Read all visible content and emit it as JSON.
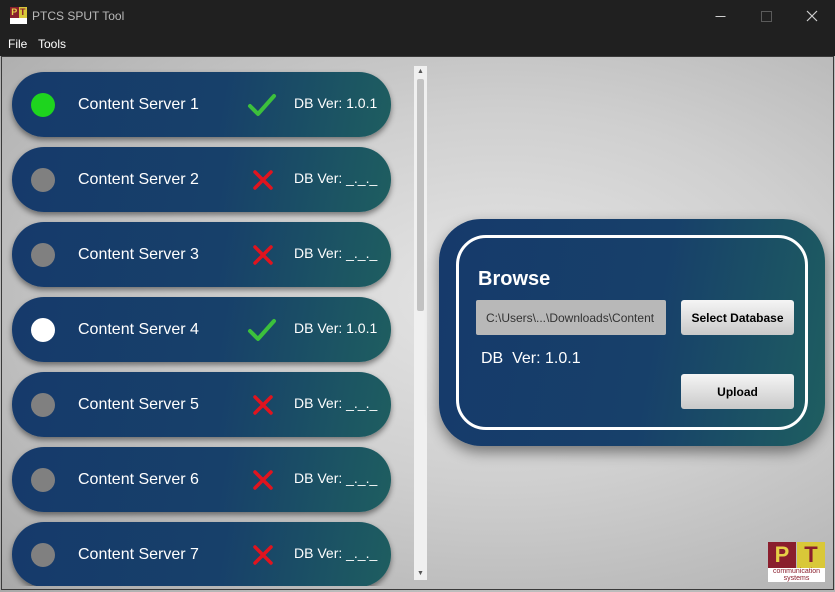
{
  "window": {
    "title": "PTCS SPUT Tool",
    "minimize_glyph": "—",
    "maximize_glyph": "☐",
    "close_glyph": "✕"
  },
  "menu": {
    "file": "File",
    "tools": "Tools"
  },
  "servers": [
    {
      "name": "Content Server 1",
      "status_color": "green",
      "db_ok": true,
      "db_ver": "DB Ver: 1.0.1"
    },
    {
      "name": "Content Server 2",
      "status_color": "gray",
      "db_ok": false,
      "db_ver": "DB Ver: _._._"
    },
    {
      "name": "Content Server 3",
      "status_color": "gray",
      "db_ok": false,
      "db_ver": "DB Ver: _._._"
    },
    {
      "name": "Content Server 4",
      "status_color": "white",
      "db_ok": true,
      "db_ver": "DB Ver: 1.0.1"
    },
    {
      "name": "Content Server 5",
      "status_color": "gray",
      "db_ok": false,
      "db_ver": "DB Ver: _._._"
    },
    {
      "name": "Content Server 6",
      "status_color": "gray",
      "db_ok": false,
      "db_ver": "DB Ver: _._._"
    },
    {
      "name": "Content Server 7",
      "status_color": "gray",
      "db_ok": false,
      "db_ver": "DB Ver: _._._"
    }
  ],
  "scrollbar": {
    "up_glyph": "▲",
    "down_glyph": "▼"
  },
  "browse": {
    "title": "Browse",
    "path_value": "C:\\Users\\...\\Downloads\\Content",
    "select_button": "Select Database",
    "db_version": "DB  Ver: 1.0.1",
    "upload_button": "Upload"
  },
  "logo": {
    "p": "P",
    "t": "T",
    "subtitle": "communication systems"
  },
  "colors": {
    "panel_start": "#163a6b",
    "panel_end": "#1e5e60",
    "status_green": "#1ed41e",
    "check_green": "#3cc03c",
    "x_red": "#e0141e",
    "logo_red": "#8a1e2d",
    "logo_yellow": "#d9c838"
  }
}
